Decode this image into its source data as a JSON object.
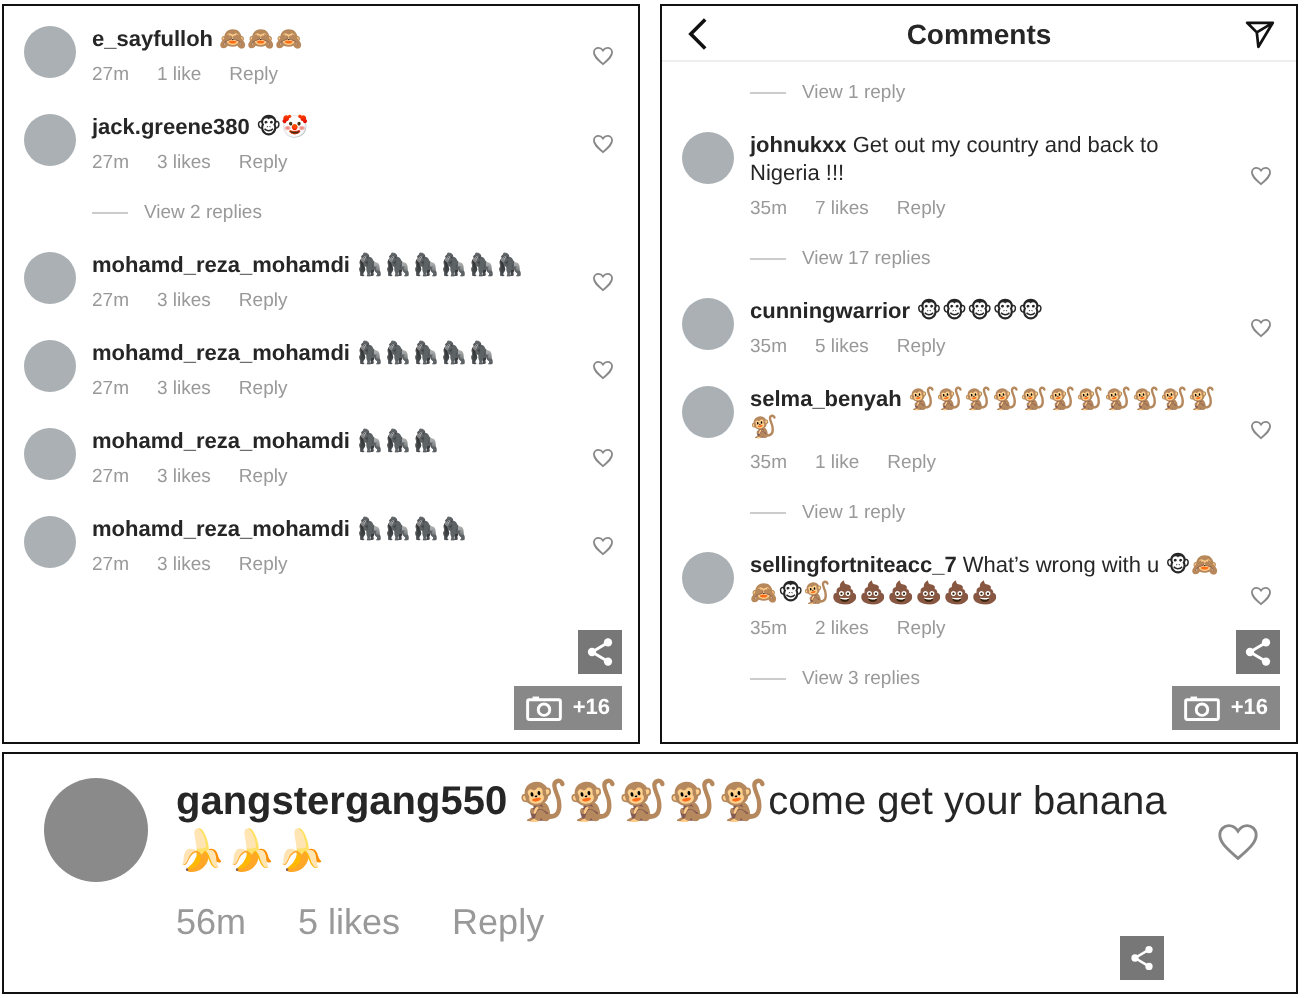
{
  "panels": [
    {
      "photo_count": "+16",
      "items": [
        {
          "kind": "comment",
          "user": "e_sayfulloh",
          "text": "🙈🙈🙈",
          "time": "27m",
          "likes": "1 like",
          "reply": "Reply"
        },
        {
          "kind": "comment",
          "user": "jack.greene380",
          "text": "🐵🤡",
          "time": "27m",
          "likes": "3 likes",
          "reply": "Reply"
        },
        {
          "kind": "replies",
          "label": "View 2 replies"
        },
        {
          "kind": "comment",
          "user": "mohamd_reza_mohamdi",
          "text": "🦍🦍🦍🦍🦍🦍",
          "time": "27m",
          "likes": "3 likes",
          "reply": "Reply"
        },
        {
          "kind": "comment",
          "user": "mohamd_reza_mohamdi",
          "text": "🦍🦍🦍🦍🦍",
          "time": "27m",
          "likes": "3 likes",
          "reply": "Reply"
        },
        {
          "kind": "comment",
          "user": "mohamd_reza_mohamdi",
          "text": "🦍🦍🦍",
          "time": "27m",
          "likes": "3 likes",
          "reply": "Reply"
        },
        {
          "kind": "comment",
          "user": "mohamd_reza_mohamdi",
          "text": "🦍🦍🦍🦍",
          "time": "27m",
          "likes": "3 likes",
          "reply": "Reply"
        }
      ]
    },
    {
      "header": {
        "title": "Comments"
      },
      "photo_count": "+16",
      "items": [
        {
          "kind": "replies",
          "label": "View 1 reply"
        },
        {
          "kind": "comment",
          "user": "johnukxx",
          "text": "Get out my country and back to Nigeria !!!",
          "time": "35m",
          "likes": "7 likes",
          "reply": "Reply"
        },
        {
          "kind": "replies",
          "label": "View 17 replies"
        },
        {
          "kind": "comment",
          "user": "cunningwarrior",
          "text": "🐵🐵🐵🐵🐵",
          "time": "35m",
          "likes": "5 likes",
          "reply": "Reply"
        },
        {
          "kind": "comment",
          "user": "selma_benyah",
          "text": "🐒🐒🐒🐒🐒🐒🐒🐒🐒🐒🐒🐒",
          "time": "35m",
          "likes": "1 like",
          "reply": "Reply"
        },
        {
          "kind": "replies",
          "label": "View 1 reply"
        },
        {
          "kind": "comment",
          "user": "sellingfortniteacc_7",
          "text": "What’s wrong with u 🐵🙈🙈🐵🐒💩💩💩💩💩💩",
          "time": "35m",
          "likes": "2 likes",
          "reply": "Reply"
        },
        {
          "kind": "replies",
          "label": "View 3 replies"
        }
      ]
    }
  ],
  "featured": {
    "user": "gangstergang550",
    "text": "🐒🐒🐒🐒🐒come get your banana🍌🍌🍌",
    "time": "56m",
    "likes": "5 likes",
    "reply": "Reply"
  }
}
